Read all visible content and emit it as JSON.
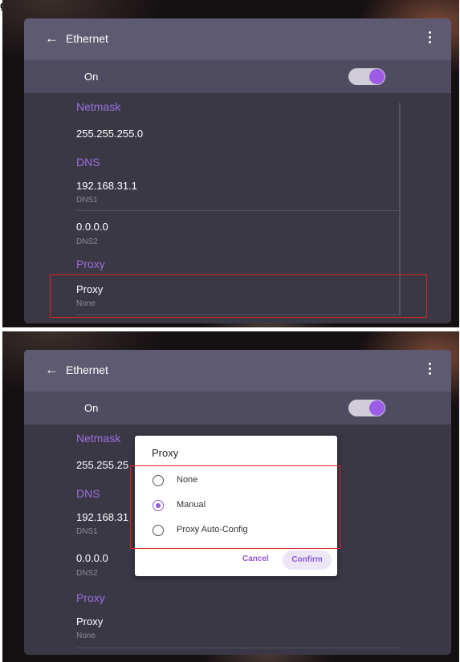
{
  "corner_mark": "g",
  "screen1": {
    "window_title": "Ethernet",
    "on_label": "On",
    "netmask_header": "Netmask",
    "netmask_value": "255.255.255.0",
    "dns_header": "DNS",
    "dns1_value": "192.168.31.1",
    "dns1_label": "DNS1",
    "dns2_value": "0.0.0.0",
    "dns2_label": "DNS2",
    "proxy_header": "Proxy",
    "proxy_label": "Proxy",
    "proxy_value": "None"
  },
  "screen2": {
    "window_title": "Ethernet",
    "on_label": "On",
    "netmask_header": "Netmask",
    "netmask_value_partial": "255.255.25",
    "dns_header": "DNS",
    "dns1_value_partial": "192.168.31",
    "dns1_label": "DNS1",
    "dns2_value": "0.0.0.0",
    "dns2_label": "DNS2",
    "proxy_header": "Proxy",
    "proxy_label": "Proxy",
    "proxy_value": "None",
    "dialog": {
      "title": "Proxy",
      "options": [
        {
          "label": "None",
          "selected": false
        },
        {
          "label": "Manual",
          "selected": true
        },
        {
          "label": "Proxy Auto-Config",
          "selected": false
        }
      ],
      "cancel_label": "Cancel",
      "confirm_label": "Confirm"
    }
  },
  "colors": {
    "accent": "#9b6fdc",
    "highlight_box": "#e02020",
    "titlebar": "#5e5a72",
    "panel": "#3b3846"
  }
}
